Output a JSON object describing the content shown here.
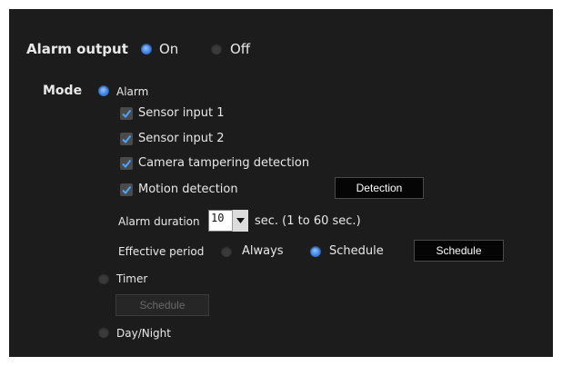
{
  "alarm_output": {
    "label": "Alarm output",
    "on_label": "On",
    "off_label": "Off",
    "selected": "On"
  },
  "mode": {
    "label": "Mode",
    "selected": "Alarm",
    "alarm": {
      "label": "Alarm",
      "sensors": [
        {
          "label": "Sensor input 1",
          "checked": true
        },
        {
          "label": "Sensor input 2",
          "checked": true
        },
        {
          "label": "Camera tampering detection",
          "checked": true
        },
        {
          "label": "Motion detection",
          "checked": true
        }
      ],
      "detection_button": "Detection",
      "alarm_duration": {
        "label": "Alarm duration",
        "value": "10",
        "unit_text": "sec. (1 to 60 sec.)"
      },
      "effective_period": {
        "label": "Effective period",
        "always_label": "Always",
        "schedule_label": "Schedule",
        "selected": "Schedule",
        "schedule_button": "Schedule"
      }
    },
    "timer": {
      "label": "Timer",
      "schedule_button": "Schedule"
    },
    "day_night": {
      "label": "Day/Night"
    }
  },
  "colors": {
    "panel_bg": "#1c1c1c",
    "radio_selected": "#3f83e6",
    "checkmark": "#4aa3ff"
  }
}
